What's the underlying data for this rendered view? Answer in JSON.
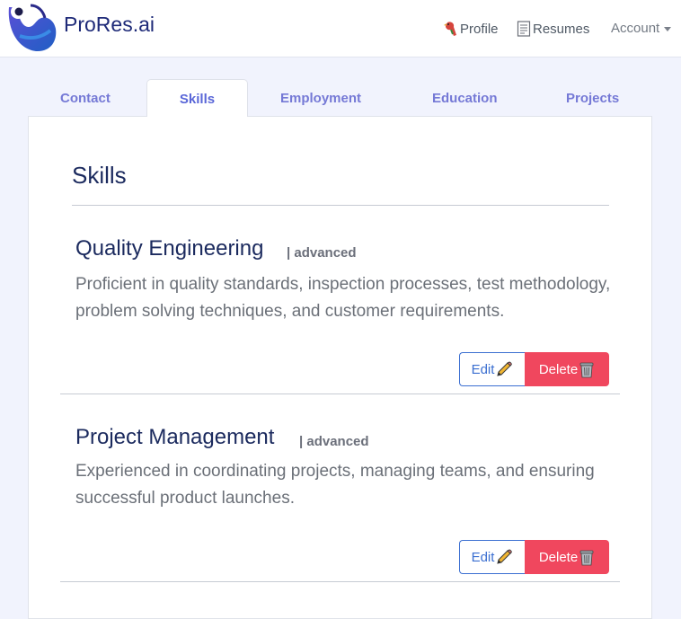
{
  "header": {
    "brand": "ProRes.ai",
    "nav": [
      {
        "label": "Profile",
        "icon": "parrot-icon"
      },
      {
        "label": "Resumes",
        "icon": "document-icon"
      },
      {
        "label": "Account",
        "icon": "caret-down-icon"
      }
    ]
  },
  "tabs": [
    {
      "label": "Contact"
    },
    {
      "label": "Skills",
      "active": true
    },
    {
      "label": "Employment"
    },
    {
      "label": "Education"
    },
    {
      "label": "Projects"
    }
  ],
  "section": {
    "title": "Skills"
  },
  "skills": [
    {
      "name": "Quality Engineering",
      "level": "| advanced",
      "description": "Proficient in quality standards, inspection processes, test methodology, problem solving techniques, and customer requirements.",
      "edit_label": "Edit",
      "delete_label": "Delete"
    },
    {
      "name": "Project Management",
      "level": "| advanced",
      "description": "Experienced in coordinating projects, managing teams, and ensuring successful product launches.",
      "edit_label": "Edit",
      "delete_label": "Delete"
    }
  ],
  "colors": {
    "brand": "#1e2a78",
    "tab_text": "#7579d6",
    "edit_outline": "#3b6fd1",
    "delete_bg": "#f0475e",
    "page_bg": "#f1f3fd"
  }
}
